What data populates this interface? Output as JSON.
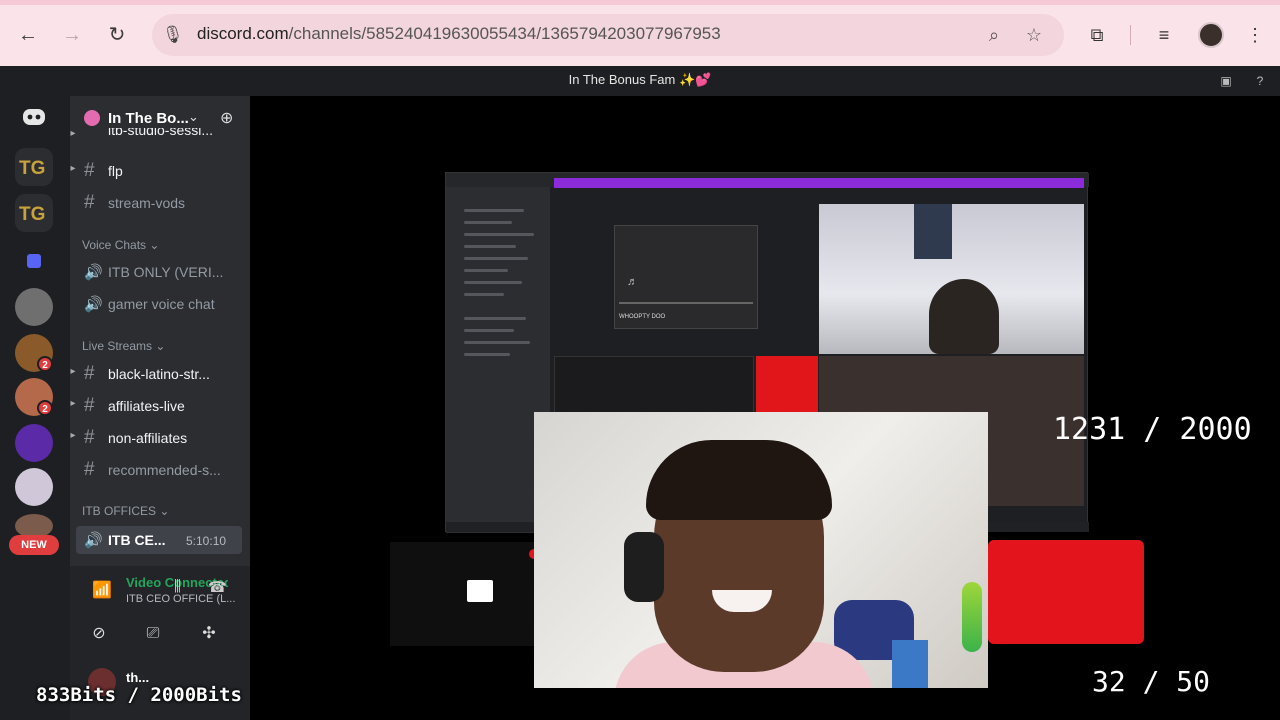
{
  "browser": {
    "url_domain": "discord.com",
    "url_path": "/channels/585240419630055434/1365794203077967953",
    "icons": [
      "back-icon",
      "forward-icon",
      "reload-icon",
      "mic-icon",
      "zoom-icon",
      "star-icon",
      "cast-icon",
      "media-icon",
      "menu-icon"
    ]
  },
  "titlebar": {
    "title": "In The Bonus Fam ✨💕"
  },
  "rail": {
    "badges": [
      "2",
      "2"
    ],
    "new_label": "NEW"
  },
  "sidebar": {
    "guild_name": "In The Bo...",
    "channels_top": [
      {
        "name": "itb-studio-sessi..."
      },
      {
        "name": "flp"
      },
      {
        "name": "stream-vods"
      }
    ],
    "voice_category": "Voice Chats",
    "voice_channels": [
      {
        "name": "ITB ONLY (VERI..."
      },
      {
        "name": "gamer voice chat"
      }
    ],
    "live_category": "Live Streams",
    "live_channels": [
      {
        "name": "black-latino-str..."
      },
      {
        "name": "affiliates-live"
      },
      {
        "name": "non-affiliates"
      },
      {
        "name": "recommended-s..."
      }
    ],
    "offices_category": "ITB OFFICES",
    "active_channel": {
      "name": "ITB CE...",
      "time": "5:10:10"
    }
  },
  "voice_panel": {
    "status": "Video Connected",
    "channel": "ITB CEO OFFICE (L..."
  },
  "user_panel": {
    "name": "th..."
  },
  "screen_share": {
    "track": "WHOOPTY DOO"
  },
  "overlay": {
    "goal_counter": "1231 / 2000",
    "sub_counter": "32 / 50",
    "bits": "833Bits / 2000Bits"
  },
  "colors": {
    "discord_dark": "#1e1f22",
    "sidebar": "#2b2d31",
    "green": "#23a55a",
    "red": "#e3141b",
    "chrome_pink": "#fbe3ea"
  }
}
